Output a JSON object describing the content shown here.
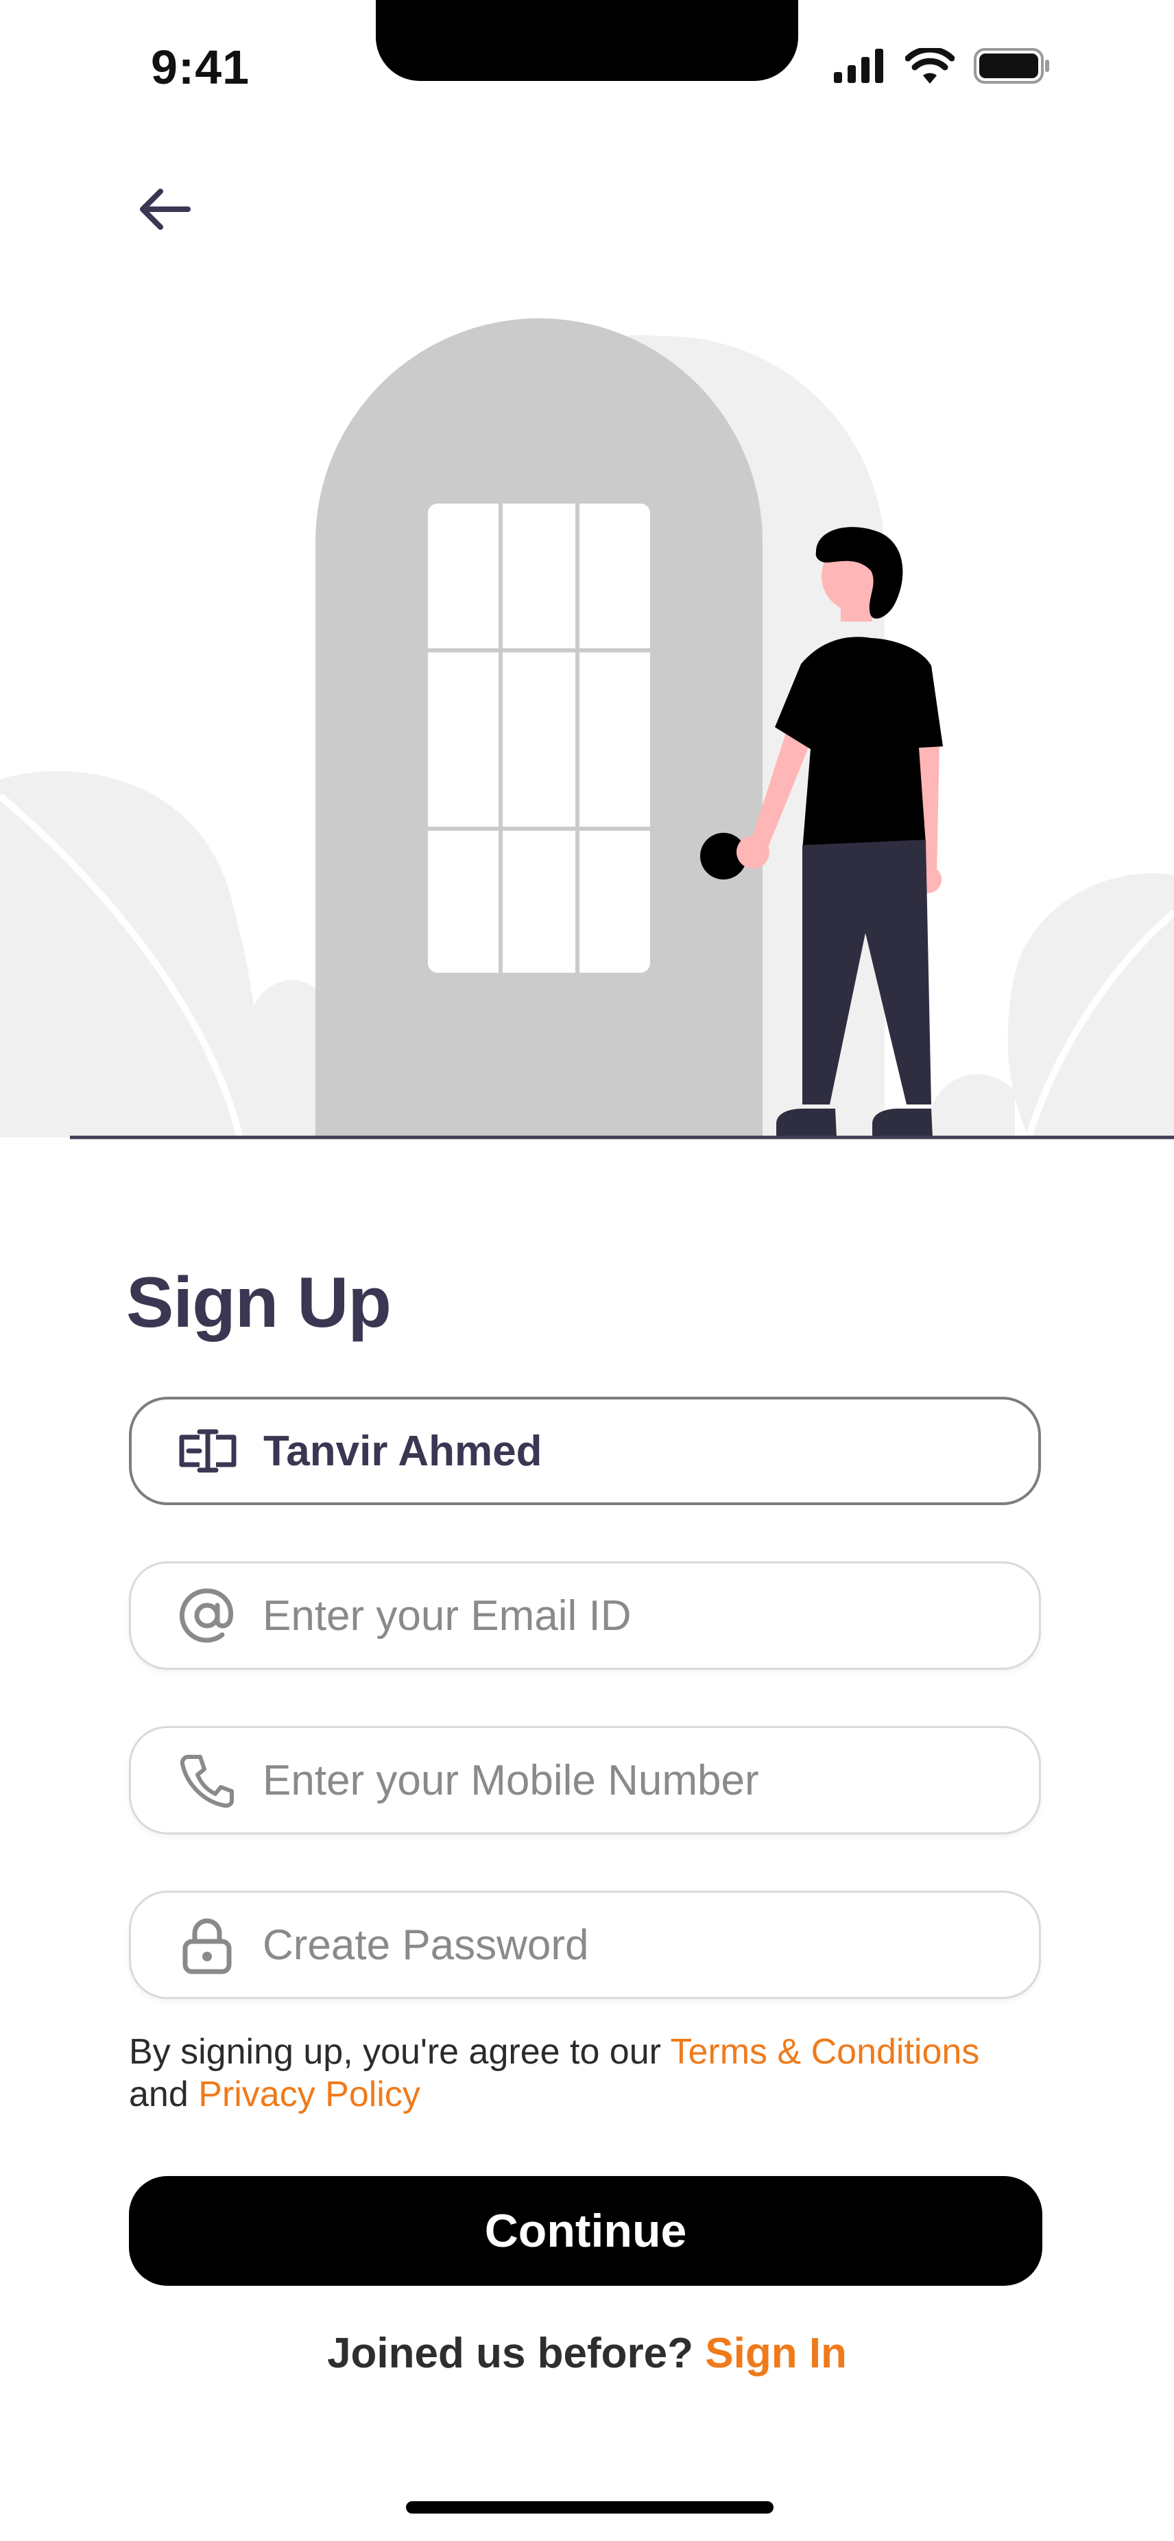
{
  "status_bar": {
    "time": "9:41",
    "icons": [
      "cellular-signal-icon",
      "wifi-icon",
      "battery-icon"
    ]
  },
  "nav": {
    "back_icon": "arrow-left-icon"
  },
  "illustration": {
    "description_icon": "person-at-door-illustration",
    "colors": {
      "door": "#cbcbcb",
      "backdrop": "#f0f0f0",
      "skin": "#ffb6b6",
      "shirt": "#000000",
      "pants": "#2f2e41",
      "ground_line": "#3f3d56"
    }
  },
  "form": {
    "title": "Sign Up",
    "fields": {
      "name": {
        "icon": "name-id-icon",
        "value": "Tanvir Ahmed",
        "placeholder": ""
      },
      "email": {
        "icon": "at-sign-icon",
        "value": "",
        "placeholder": "Enter your Email ID"
      },
      "phone": {
        "icon": "phone-icon",
        "value": "",
        "placeholder": "Enter your Mobile Number"
      },
      "password": {
        "icon": "lock-icon",
        "value": "",
        "placeholder": "Create Password"
      }
    },
    "terms": {
      "prefix": "By signing up, you're agree to our ",
      "terms_link": "Terms & Conditions",
      "middle": "and ",
      "privacy_link": "Privacy Policy"
    },
    "continue_label": "Continue",
    "signin": {
      "prompt": "Joined us before? ",
      "link": "Sign In"
    }
  },
  "colors": {
    "accent": "#f07a1a",
    "title": "#3b3652",
    "button": "#000000"
  }
}
